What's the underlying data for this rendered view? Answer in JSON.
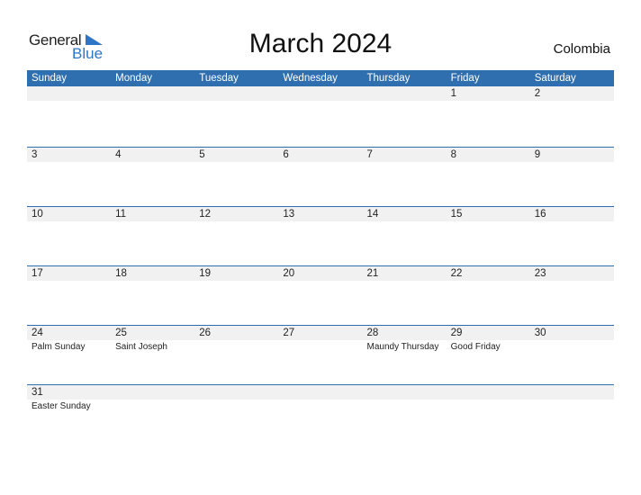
{
  "logo": {
    "general": "General",
    "blue": "Blue"
  },
  "title": "March 2024",
  "country": "Colombia",
  "colors": {
    "header": "#2f6fb0",
    "band": "#f1f1f1",
    "logo_blue": "#2e75c7"
  },
  "weekdays": [
    "Sunday",
    "Monday",
    "Tuesday",
    "Wednesday",
    "Thursday",
    "Friday",
    "Saturday"
  ],
  "weeks": [
    [
      {
        "d": ""
      },
      {
        "d": ""
      },
      {
        "d": ""
      },
      {
        "d": ""
      },
      {
        "d": ""
      },
      {
        "d": "1"
      },
      {
        "d": "2"
      }
    ],
    [
      {
        "d": "3"
      },
      {
        "d": "4"
      },
      {
        "d": "5"
      },
      {
        "d": "6"
      },
      {
        "d": "7"
      },
      {
        "d": "8"
      },
      {
        "d": "9"
      }
    ],
    [
      {
        "d": "10"
      },
      {
        "d": "11"
      },
      {
        "d": "12"
      },
      {
        "d": "13"
      },
      {
        "d": "14"
      },
      {
        "d": "15"
      },
      {
        "d": "16"
      }
    ],
    [
      {
        "d": "17"
      },
      {
        "d": "18"
      },
      {
        "d": "19"
      },
      {
        "d": "20"
      },
      {
        "d": "21"
      },
      {
        "d": "22"
      },
      {
        "d": "23"
      }
    ],
    [
      {
        "d": "24",
        "h": "Palm Sunday"
      },
      {
        "d": "25",
        "h": "Saint Joseph"
      },
      {
        "d": "26"
      },
      {
        "d": "27"
      },
      {
        "d": "28",
        "h": "Maundy Thursday"
      },
      {
        "d": "29",
        "h": "Good Friday"
      },
      {
        "d": "30"
      }
    ],
    [
      {
        "d": "31",
        "h": "Easter Sunday"
      },
      {
        "d": ""
      },
      {
        "d": ""
      },
      {
        "d": ""
      },
      {
        "d": ""
      },
      {
        "d": ""
      },
      {
        "d": ""
      }
    ]
  ]
}
